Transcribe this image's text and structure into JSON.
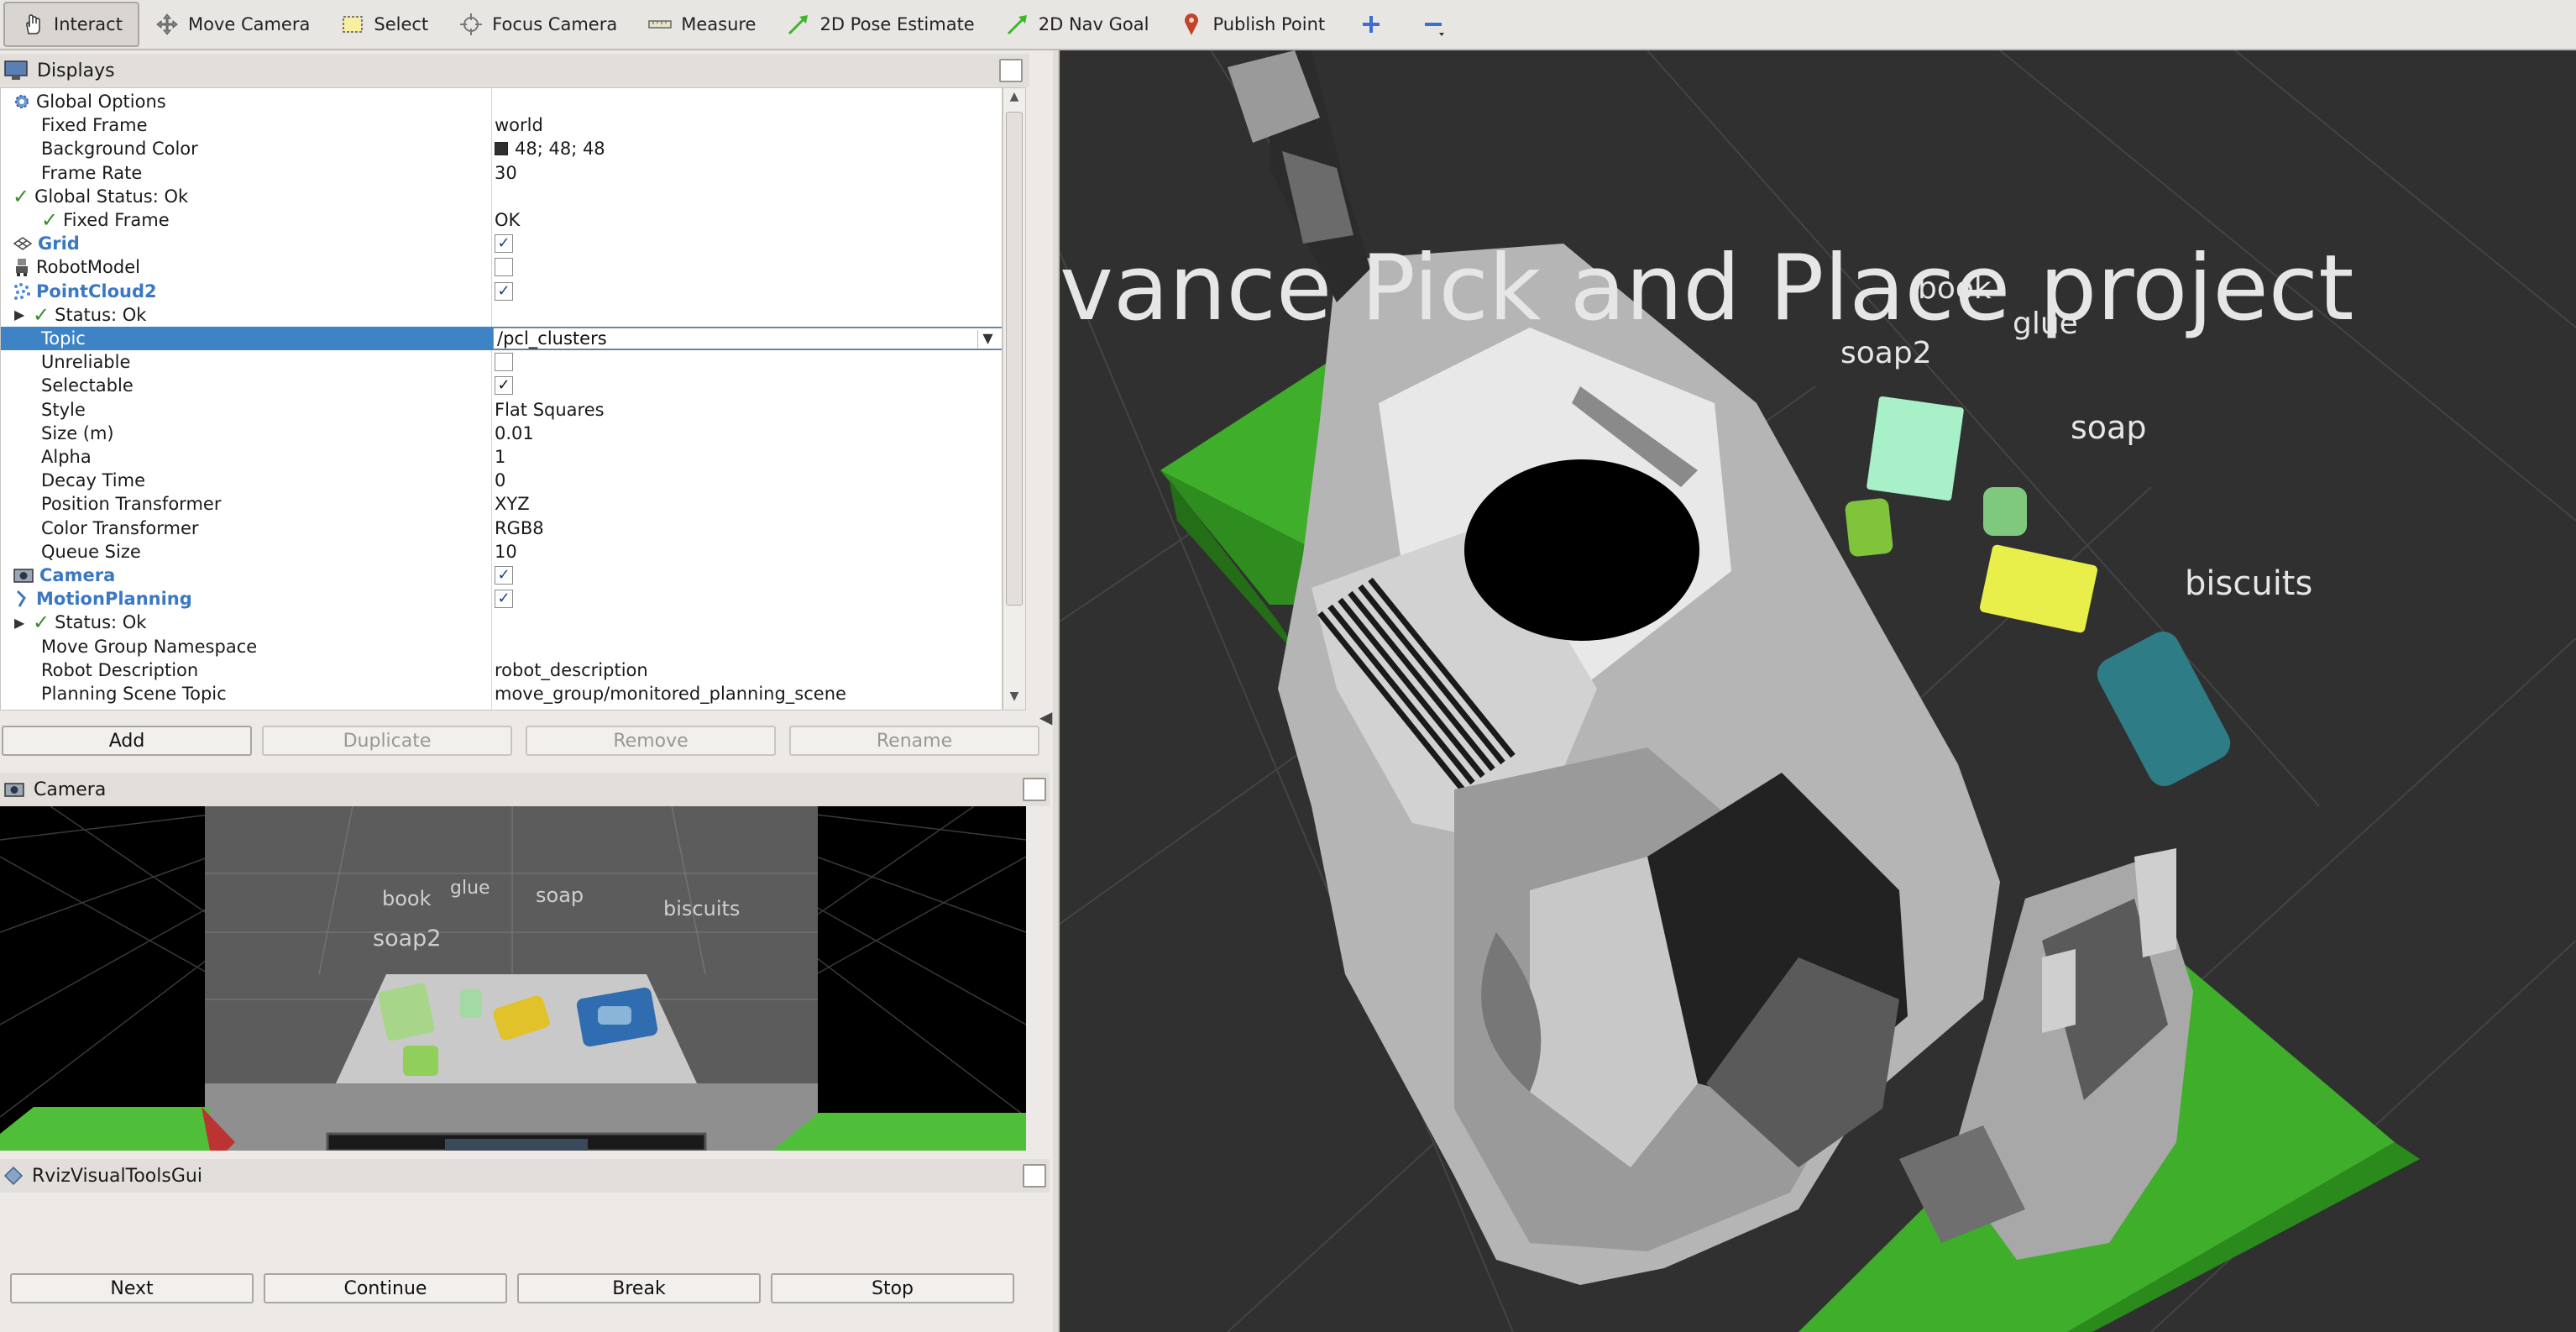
{
  "toolbar": {
    "tools": [
      {
        "label": "Interact",
        "icon": "hand-icon",
        "active": true
      },
      {
        "label": "Move Camera",
        "icon": "move-camera-icon"
      },
      {
        "label": "Select",
        "icon": "select-box-icon"
      },
      {
        "label": "Focus Camera",
        "icon": "focus-icon"
      },
      {
        "label": "Measure",
        "icon": "ruler-icon"
      },
      {
        "label": "2D Pose Estimate",
        "icon": "green-arrow-icon"
      },
      {
        "label": "2D Nav Goal",
        "icon": "green-arrow-icon"
      },
      {
        "label": "Publish Point",
        "icon": "map-pin-icon"
      }
    ],
    "add_icon": "plus-icon",
    "remove_icon": "minus-icon"
  },
  "displays": {
    "title": "Displays",
    "rows": [
      {
        "name": "Global Options",
        "value": ""
      },
      {
        "name": "Fixed Frame",
        "value": "world"
      },
      {
        "name": "Background Color",
        "value": "48; 48; 48"
      },
      {
        "name": "Frame Rate",
        "value": "30"
      },
      {
        "name": "Global Status: Ok",
        "value": ""
      },
      {
        "name": "Fixed Frame",
        "value": "OK"
      },
      {
        "name": "Grid",
        "value": ""
      },
      {
        "name": "RobotModel",
        "value": ""
      },
      {
        "name": "PointCloud2",
        "value": ""
      },
      {
        "name": "Status: Ok",
        "value": ""
      },
      {
        "name": "Topic",
        "value": "/pcl_clusters"
      },
      {
        "name": "Unreliable",
        "value": ""
      },
      {
        "name": "Selectable",
        "value": ""
      },
      {
        "name": "Style",
        "value": "Flat Squares"
      },
      {
        "name": "Size (m)",
        "value": "0.01"
      },
      {
        "name": "Alpha",
        "value": "1"
      },
      {
        "name": "Decay Time",
        "value": "0"
      },
      {
        "name": "Position Transformer",
        "value": "XYZ"
      },
      {
        "name": "Color Transformer",
        "value": "RGB8"
      },
      {
        "name": "Queue Size",
        "value": "10"
      },
      {
        "name": "Camera",
        "value": ""
      },
      {
        "name": "MotionPlanning",
        "value": ""
      },
      {
        "name": "Status: Ok",
        "value": ""
      },
      {
        "name": "Move Group Namespace",
        "value": ""
      },
      {
        "name": "Robot Description",
        "value": "robot_description"
      },
      {
        "name": "Planning Scene Topic",
        "value": "move_group/monitored_planning_scene"
      }
    ],
    "buttons": {
      "add": "Add",
      "duplicate": "Duplicate",
      "remove": "Remove",
      "rename": "Rename"
    }
  },
  "camera_panel": {
    "title": "Camera",
    "labels": [
      "book",
      "glue",
      "soap",
      "biscuits",
      "soap2"
    ]
  },
  "rviz_tools": {
    "title": "RvizVisualToolsGui",
    "buttons": {
      "next": "Next",
      "continue": "Continue",
      "break": "Break",
      "stop": "Stop"
    }
  },
  "scene": {
    "banner": "vance  Pick  and  Place  project",
    "labels": {
      "book": "book",
      "glue": "glue",
      "soap2": "soap2",
      "soap": "soap",
      "biscuits": "biscuits"
    },
    "colors": {
      "background": "#303030",
      "table": "#3fae2a",
      "soap2": "#a8f0c8",
      "glue": "#7ec97e",
      "soap": "#e8ee4a",
      "biscuits": "#2e7c86",
      "book_small": "#7fc43a"
    }
  }
}
